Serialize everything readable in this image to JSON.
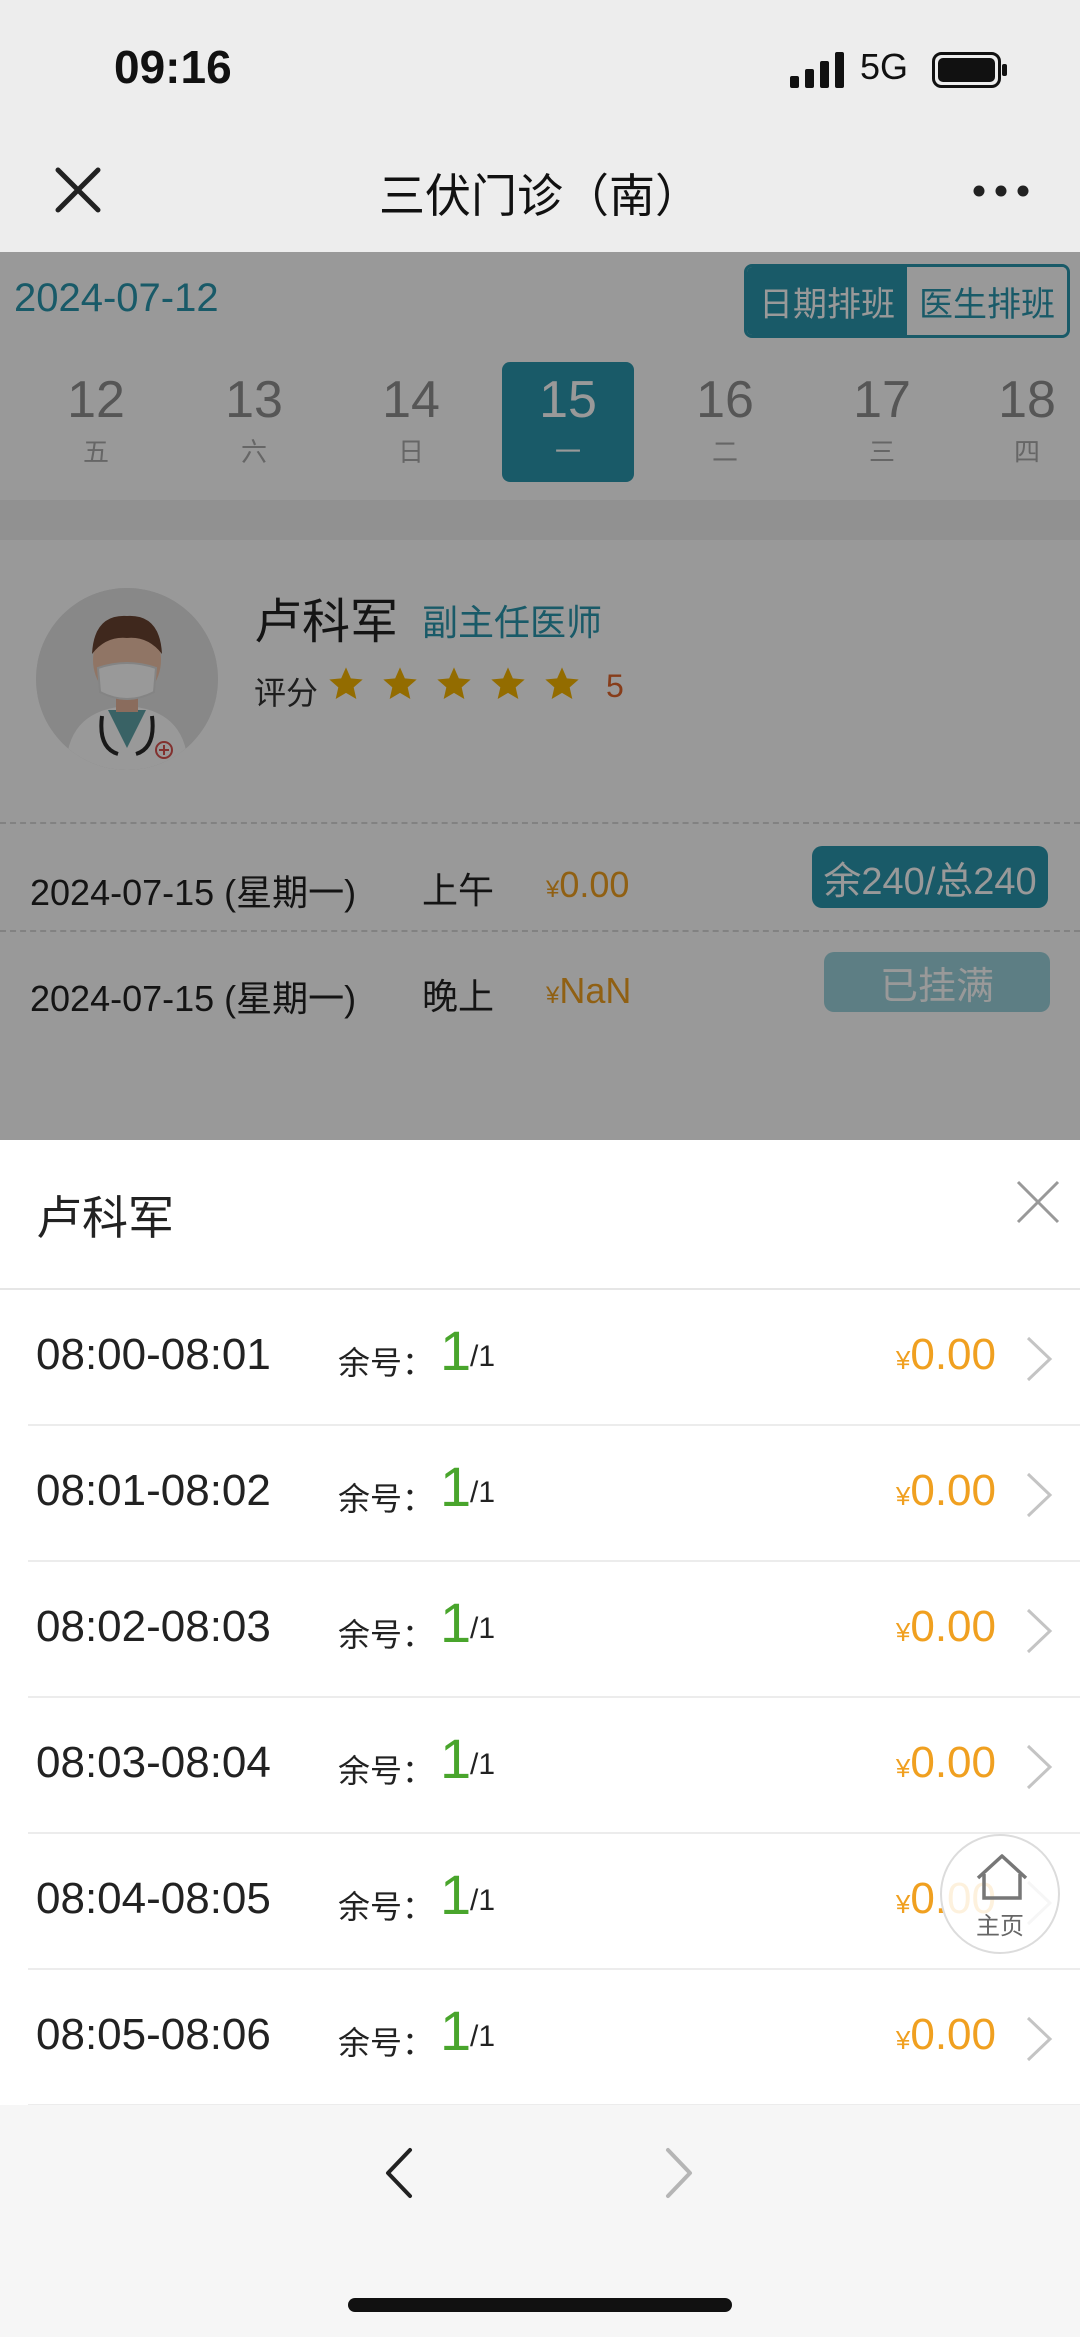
{
  "status_bar": {
    "time": "09:16",
    "network": "5G"
  },
  "nav": {
    "title": "三伏门诊（南）"
  },
  "schedule": {
    "current_date": "2024-07-12",
    "tabs": [
      {
        "label": "日期排班",
        "active": true
      },
      {
        "label": "医生排班",
        "active": false
      }
    ],
    "days": [
      {
        "num": "12",
        "weekday": "五"
      },
      {
        "num": "13",
        "weekday": "六"
      },
      {
        "num": "14",
        "weekday": "日"
      },
      {
        "num": "15",
        "weekday": "一"
      },
      {
        "num": "16",
        "weekday": "二"
      },
      {
        "num": "17",
        "weekday": "三"
      },
      {
        "num": "18",
        "weekday": "四"
      }
    ],
    "selected_day_index": 3
  },
  "doctor": {
    "name": "卢科军",
    "title": "副主任医师",
    "rating_label": "评分",
    "rating": "5",
    "stars": 5
  },
  "sessions": [
    {
      "date": "2024-07-15 (星期一)",
      "period": "上午",
      "currency": "¥",
      "price": "0.00",
      "status": "余240/总240"
    },
    {
      "date": "2024-07-15 (星期一)",
      "period": "晚上",
      "currency": "¥",
      "price": "NaN",
      "status": "已挂满"
    }
  ],
  "sheet": {
    "title": "卢科军",
    "remaining_label": "余号：",
    "slots": [
      {
        "time": "08:00-08:01",
        "remaining": "1",
        "total": "/1",
        "currency": "¥",
        "price": "0.00"
      },
      {
        "time": "08:01-08:02",
        "remaining": "1",
        "total": "/1",
        "currency": "¥",
        "price": "0.00"
      },
      {
        "time": "08:02-08:03",
        "remaining": "1",
        "total": "/1",
        "currency": "¥",
        "price": "0.00"
      },
      {
        "time": "08:03-08:04",
        "remaining": "1",
        "total": "/1",
        "currency": "¥",
        "price": "0.00"
      },
      {
        "time": "08:04-08:05",
        "remaining": "1",
        "total": "/1",
        "currency": "¥",
        "price": "0.00"
      },
      {
        "time": "08:05-08:06",
        "remaining": "1",
        "total": "/1",
        "currency": "¥",
        "price": "0.00"
      }
    ]
  },
  "floating_home": {
    "label": "主页"
  },
  "colors": {
    "accent": "#2b97ad",
    "price": "#f0a020",
    "remaining": "#49a52c",
    "rating": "#e2662c"
  }
}
